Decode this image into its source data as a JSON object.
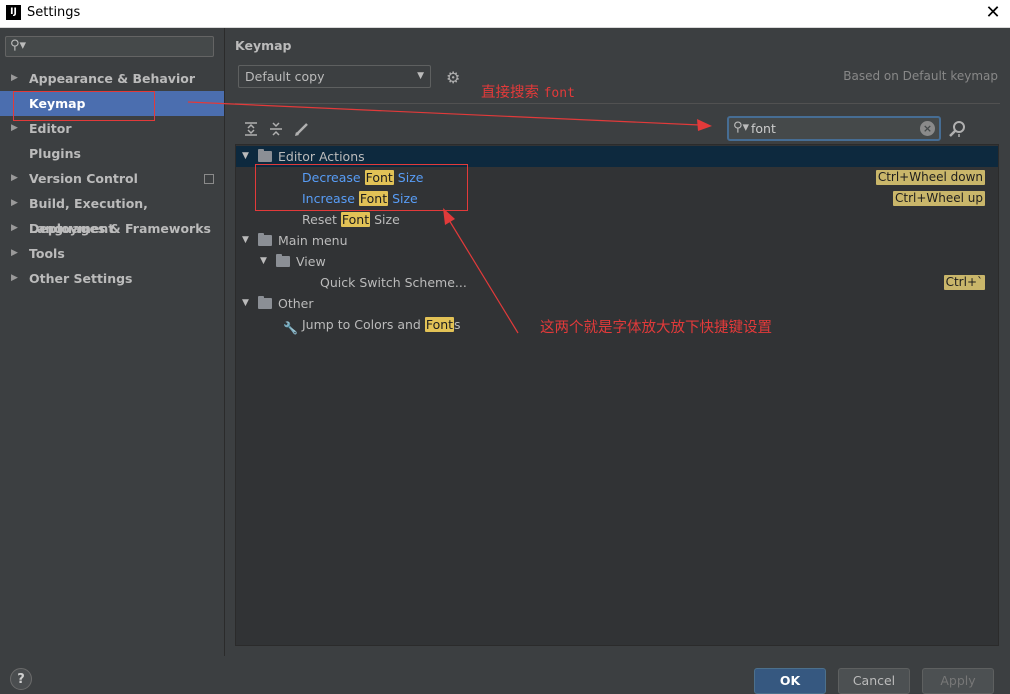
{
  "window": {
    "app_icon_label": "IJ",
    "title": "Settings",
    "close_glyph": "✕"
  },
  "sidebar": {
    "search_placeholder": "",
    "items": [
      {
        "label": "Appearance & Behavior",
        "expandable": true
      },
      {
        "label": "Keymap",
        "expandable": false,
        "selected": true
      },
      {
        "label": "Editor",
        "expandable": true
      },
      {
        "label": "Plugins",
        "expandable": false
      },
      {
        "label": "Version Control",
        "expandable": true,
        "has_project_icon": true
      },
      {
        "label": "Build, Execution, Deployment",
        "expandable": true
      },
      {
        "label": "Languages & Frameworks",
        "expandable": true
      },
      {
        "label": "Tools",
        "expandable": true
      },
      {
        "label": "Other Settings",
        "expandable": true
      }
    ]
  },
  "keymap": {
    "title": "Keymap",
    "scheme": "Default copy",
    "based_on": "Based on Default keymap",
    "filter_value": "font",
    "toolbar_icons": [
      "expand-all-icon",
      "collapse-all-icon",
      "edit-icon"
    ],
    "tree": [
      {
        "level": 0,
        "expanded": true,
        "folder": true,
        "parts": [
          "Editor Actions"
        ],
        "selected": true
      },
      {
        "level": 1,
        "leaf": true,
        "modified": true,
        "parts": [
          "Decrease ",
          "Font",
          " Size"
        ],
        "shortcut": "Ctrl+Wheel down"
      },
      {
        "level": 1,
        "leaf": true,
        "modified": true,
        "parts": [
          "Increase ",
          "Font",
          " Size"
        ],
        "shortcut": "Ctrl+Wheel up"
      },
      {
        "level": 1,
        "leaf": true,
        "parts": [
          "Reset ",
          "Font",
          " Size"
        ]
      },
      {
        "level": 0,
        "expanded": true,
        "folder": true,
        "parts": [
          "Main menu"
        ]
      },
      {
        "level": 1,
        "expanded": true,
        "folder": true,
        "parts": [
          "View"
        ]
      },
      {
        "level": 2,
        "leaf": true,
        "parts": [
          "Quick Switch Scheme..."
        ],
        "shortcut": "Ctrl+`"
      },
      {
        "level": 0,
        "expanded": true,
        "folder": true,
        "parts": [
          "Other"
        ]
      },
      {
        "level": 1,
        "leaf": true,
        "wrench": true,
        "parts": [
          "Jump to Colors and ",
          "Font",
          "s"
        ]
      }
    ]
  },
  "buttons": {
    "help": "?",
    "ok": "OK",
    "cancel": "Cancel",
    "apply": "Apply"
  },
  "annotations": {
    "search_hint_prefix": "直接搜索 ",
    "search_hint_code": "font",
    "note": "这两个就是字体放大放下快捷键设置"
  },
  "colors": {
    "accent": "#4b6eaf",
    "highlight": "#e2c256",
    "modified_text": "#589df6",
    "annotation": "#e23a3a"
  }
}
